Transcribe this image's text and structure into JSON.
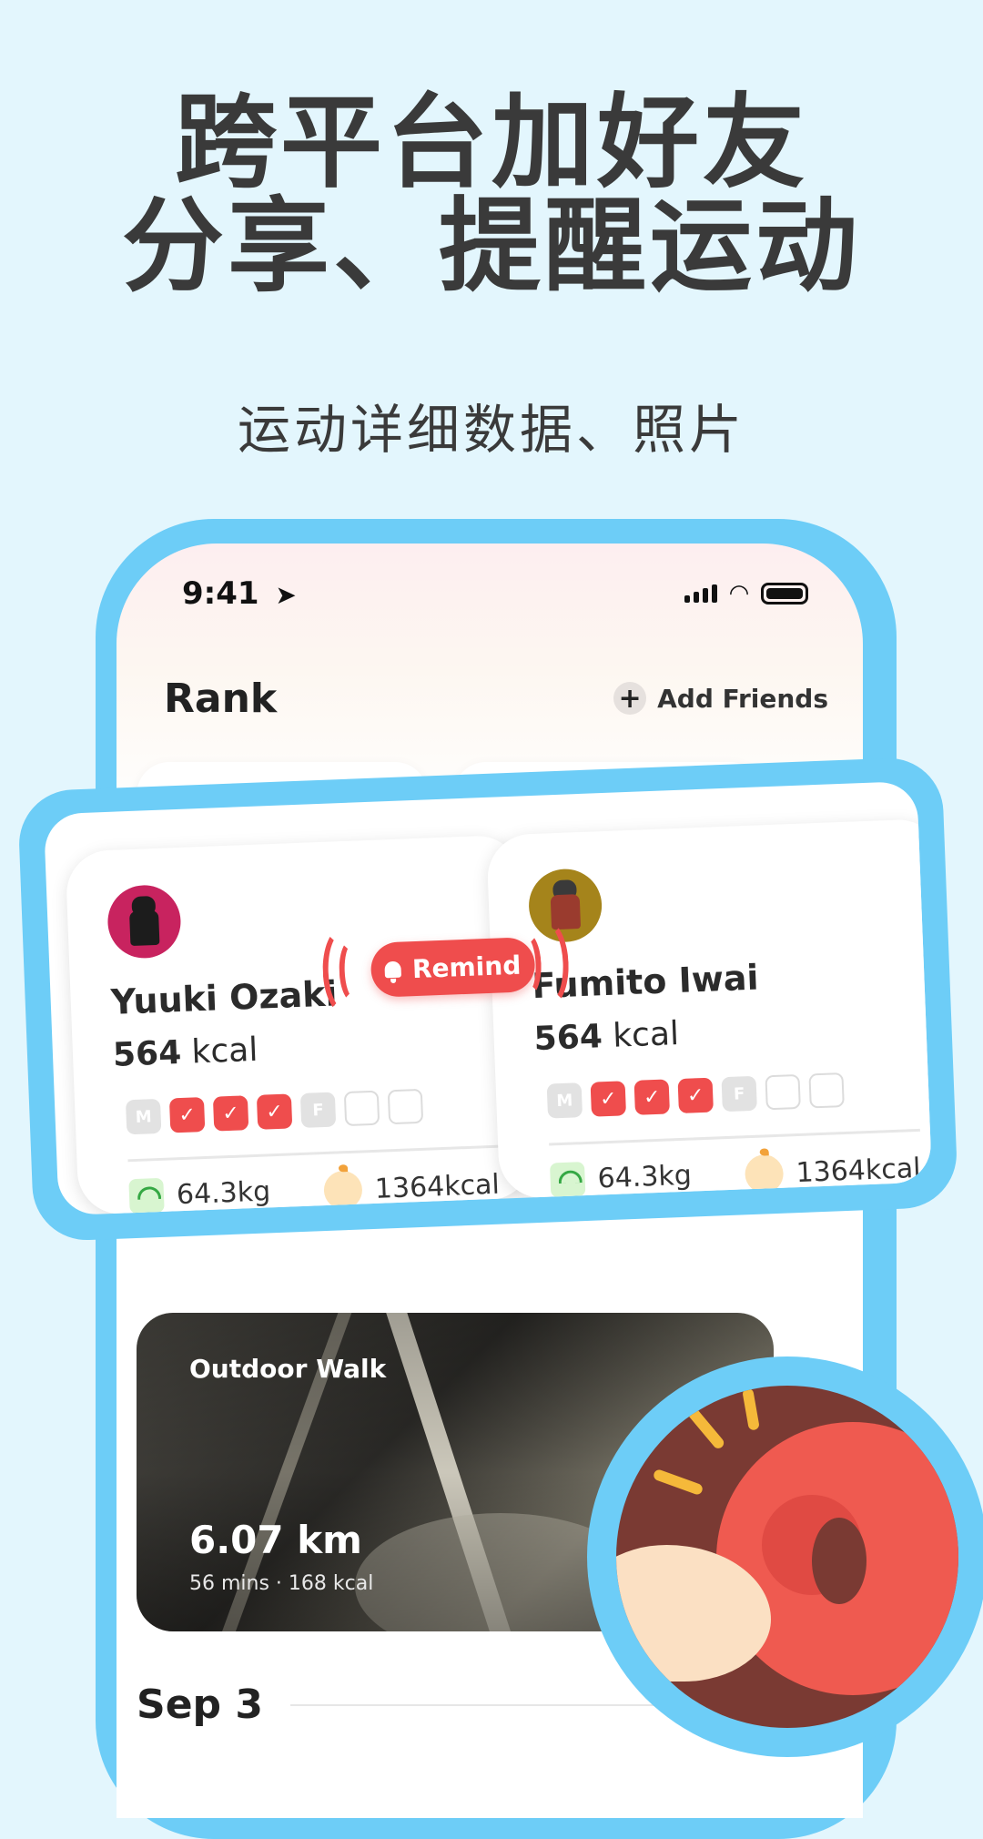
{
  "headline": {
    "line1": "跨平台加好友",
    "line2": "分享、提醒运动"
  },
  "subheadline": "运动详细数据、照片",
  "status_bar": {
    "time": "9:41"
  },
  "header": {
    "title": "Rank",
    "add_friends": "Add Friends"
  },
  "friends": [
    {
      "name": "Yuuki Ozaki",
      "kcal_value": "564",
      "kcal_unit": "kcal",
      "days": [
        {
          "label": "M",
          "state": "off"
        },
        {
          "label": "✓",
          "state": "done"
        },
        {
          "label": "✓",
          "state": "done"
        },
        {
          "label": "✓",
          "state": "done"
        },
        {
          "label": "F",
          "state": "off"
        },
        {
          "label": "",
          "state": "empty"
        },
        {
          "label": "",
          "state": "empty"
        }
      ],
      "weight": "64.3kg",
      "calories_total": "1364kcal",
      "avatar_color": "#c8235f"
    },
    {
      "name": "Fumito Iwai",
      "kcal_value": "564",
      "kcal_unit": "kcal",
      "days": [
        {
          "label": "M",
          "state": "off"
        },
        {
          "label": "✓",
          "state": "done"
        },
        {
          "label": "✓",
          "state": "done"
        },
        {
          "label": "✓",
          "state": "done"
        },
        {
          "label": "F",
          "state": "off"
        },
        {
          "label": "",
          "state": "empty"
        },
        {
          "label": "",
          "state": "empty"
        }
      ],
      "weight": "64.3kg",
      "calories_total": "1364kcal",
      "avatar_color": "#a5841b"
    }
  ],
  "remind_button": "Remind",
  "workout": {
    "type": "Outdoor Walk",
    "distance": "6.07 km",
    "meta": "56 mins · 168 kcal"
  },
  "date_header": "Sep 3",
  "colors": {
    "accent_blue": "#6dcdf7",
    "accent_red": "#ef4d4d",
    "background": "#e3f6fd"
  }
}
